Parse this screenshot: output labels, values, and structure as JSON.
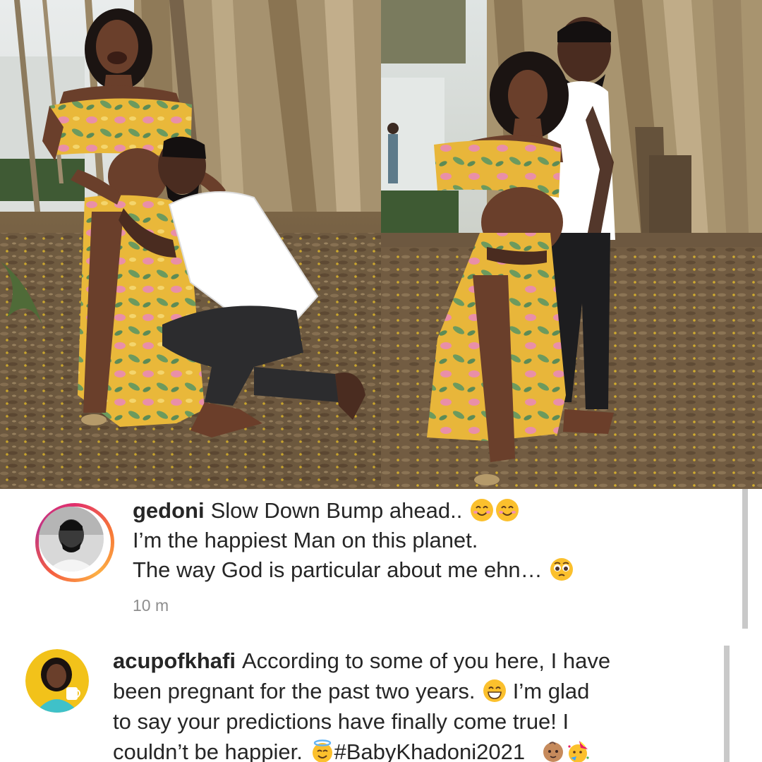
{
  "photos": [
    {
      "name": "left-photo"
    },
    {
      "name": "right-photo"
    }
  ],
  "comments": [
    {
      "username": "gedoni",
      "lines": [
        "Slow Down Bump ahead..",
        "I’m the happiest Man on this planet.",
        "The way God is particular about me ehn…"
      ],
      "timestamp": "10 m",
      "icons": [
        "smiling-face-emoji",
        "smiling-face-emoji",
        "pleading-face-emoji"
      ]
    },
    {
      "username": "acupofkhafi",
      "lines": [
        "According to some of you here, I have",
        "been pregnant for the past two years.",
        "I’m glad",
        "to say your predictions have finally come true! I",
        "couldn’t be happier.",
        "#BabyKhadoni2021"
      ],
      "icons": [
        "grinning-face-emoji",
        "halo-face-emoji",
        "baby-emoji",
        "party-face-emoji"
      ]
    }
  ],
  "colors": {
    "text": "#262626",
    "muted": "#8e8e8e",
    "ring_start": "#e1306c",
    "ring_end": "#fcaf45",
    "avatar2_bg": "#f2c21a"
  }
}
